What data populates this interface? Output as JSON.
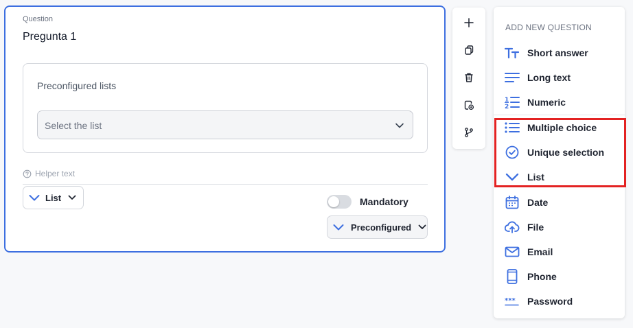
{
  "question": {
    "caption": "Question",
    "title": "Pregunta 1",
    "list_box_title": "Preconfigured lists",
    "select_placeholder": "Select the list",
    "helper_text": "Helper text",
    "type_label": "List",
    "mandatory_label": "Mandatory",
    "mandatory_on": false,
    "source_label": "Preconfigured"
  },
  "toolbar": {
    "tools": [
      "add-icon",
      "duplicate-icon",
      "trash-icon",
      "clipboard-add-icon",
      "branch-icon"
    ]
  },
  "panel": {
    "title": "ADD NEW QUESTION",
    "options": [
      {
        "label": "Short answer",
        "icon": "text-size-icon"
      },
      {
        "label": "Long text",
        "icon": "long-text-icon"
      },
      {
        "label": "Numeric",
        "icon": "numeric-list-icon"
      },
      {
        "label": "Multiple choice",
        "icon": "bullet-list-icon"
      },
      {
        "label": "Unique selection",
        "icon": "check-circle-icon"
      },
      {
        "label": "List",
        "icon": "chevron-down-icon"
      },
      {
        "label": "Date",
        "icon": "calendar-icon"
      },
      {
        "label": "File",
        "icon": "cloud-upload-icon"
      },
      {
        "label": "Email",
        "icon": "mail-icon"
      },
      {
        "label": "Phone",
        "icon": "phone-icon"
      },
      {
        "label": "Password",
        "icon": "password-icon"
      }
    ]
  },
  "colors": {
    "accent": "#3d6fe0",
    "highlight": "#e32222"
  }
}
